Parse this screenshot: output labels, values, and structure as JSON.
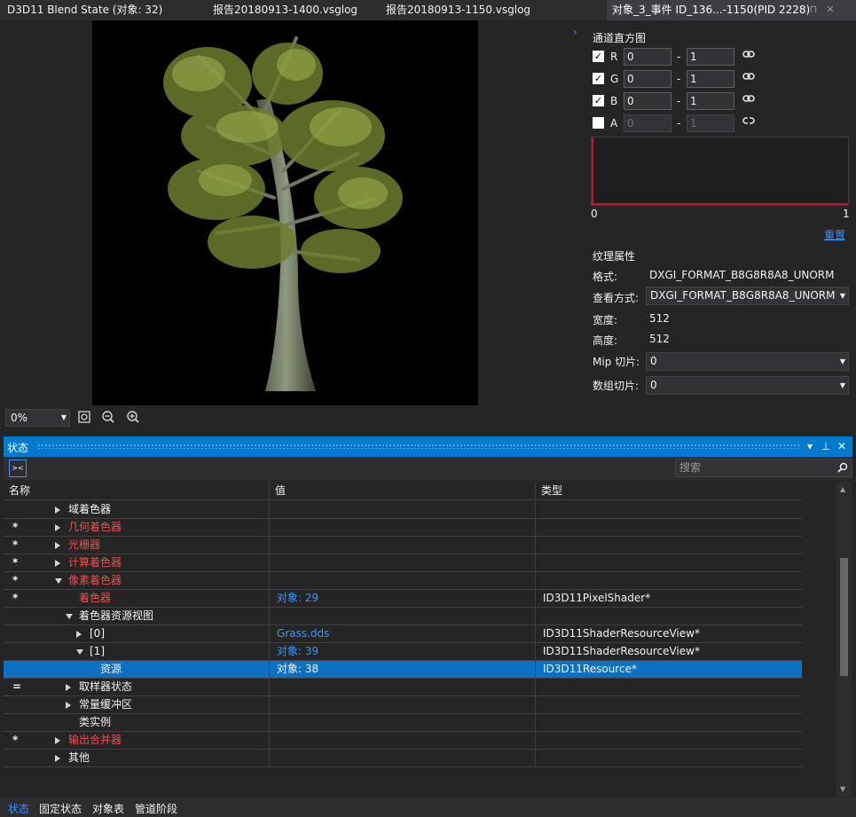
{
  "tabs": [
    {
      "label": "D3D11 Blend State (对象: 32)"
    },
    {
      "label": "报告20180913-1400.vsglog"
    },
    {
      "label": "报告20180913-1150.vsglog"
    },
    {
      "label": "对象_3_事件 ID_136...-1150(PID 2228)"
    }
  ],
  "right_panel": {
    "histogram_title": "通道直方图",
    "channels": [
      {
        "name": "R",
        "checked": true,
        "min": "0",
        "max": "1"
      },
      {
        "name": "G",
        "checked": true,
        "min": "0",
        "max": "1"
      },
      {
        "name": "B",
        "checked": true,
        "min": "0",
        "max": "1"
      },
      {
        "name": "A",
        "checked": false,
        "min": "0",
        "max": "1"
      }
    ],
    "dash": "-",
    "hist_min": "0",
    "hist_max": "1",
    "reset": "重置",
    "tex_props_title": "纹理属性",
    "format_label": "格式:",
    "format_value": "DXGI_FORMAT_B8G8R8A8_UNORM",
    "view_label": "查看方式:",
    "view_value": "DXGI_FORMAT_B8G8R8A8_UNORM",
    "width_label": "宽度:",
    "width_value": "512",
    "height_label": "高度:",
    "height_value": "512",
    "mip_label": "Mip 切片:",
    "mip_value": "0",
    "array_label": "数组切片:",
    "array_value": "0"
  },
  "zoom": {
    "value": "0%"
  },
  "status_window": {
    "title": "状态",
    "search_placeholder": "搜索",
    "columns": [
      "名称",
      "值",
      "类型"
    ],
    "rows": [
      {
        "mark": "",
        "indent": 1,
        "expander": "right",
        "name": "域着色器",
        "name_color": "white",
        "value": "",
        "value_color": "white",
        "type": ""
      },
      {
        "mark": "*",
        "indent": 1,
        "expander": "right",
        "name": "几何着色器",
        "name_color": "red",
        "value": "",
        "value_color": "white",
        "type": ""
      },
      {
        "mark": "*",
        "indent": 1,
        "expander": "right",
        "name": "光栅器",
        "name_color": "red",
        "value": "",
        "value_color": "white",
        "type": ""
      },
      {
        "mark": "*",
        "indent": 1,
        "expander": "right",
        "name": "计算着色器",
        "name_color": "red",
        "value": "",
        "value_color": "white",
        "type": ""
      },
      {
        "mark": "*",
        "indent": 1,
        "expander": "down",
        "name": "像素着色器",
        "name_color": "red",
        "value": "",
        "value_color": "white",
        "type": ""
      },
      {
        "mark": "*",
        "indent": 2,
        "expander": "",
        "name": "着色器",
        "name_color": "red",
        "value": "对象: 29",
        "value_color": "blue",
        "type": "ID3D11PixelShader*"
      },
      {
        "mark": "",
        "indent": 2,
        "expander": "down",
        "name": "着色器资源视图",
        "name_color": "white",
        "value": "",
        "value_color": "white",
        "type": ""
      },
      {
        "mark": "",
        "indent": 3,
        "expander": "right",
        "name": "[0]",
        "name_color": "white",
        "value": "Grass.dds",
        "value_color": "blue",
        "type": "ID3D11ShaderResourceView*"
      },
      {
        "mark": "",
        "indent": 3,
        "expander": "down",
        "name": "[1]",
        "name_color": "white",
        "value": "对象: 39",
        "value_color": "blue",
        "type": "ID3D11ShaderResourceView*"
      },
      {
        "mark": "",
        "indent": 4,
        "expander": "",
        "name": "资源",
        "name_color": "white",
        "value": "对象: 38",
        "value_color": "white",
        "type": "ID3D11Resource*",
        "selected": true
      },
      {
        "mark": "=",
        "indent": 2,
        "expander": "right",
        "name": "取样器状态",
        "name_color": "white",
        "value": "",
        "value_color": "white",
        "type": ""
      },
      {
        "mark": "",
        "indent": 2,
        "expander": "right",
        "name": "常量缓冲区",
        "name_color": "white",
        "value": "",
        "value_color": "white",
        "type": ""
      },
      {
        "mark": "",
        "indent": 2,
        "expander": "",
        "name": "类实例",
        "name_color": "white",
        "value": "",
        "value_color": "white",
        "type": ""
      },
      {
        "mark": "*",
        "indent": 1,
        "expander": "right",
        "name": "输出合并器",
        "name_color": "red",
        "value": "",
        "value_color": "white",
        "type": ""
      },
      {
        "mark": "",
        "indent": 1,
        "expander": "right",
        "name": "其他",
        "name_color": "white",
        "value": "",
        "value_color": "white",
        "type": ""
      }
    ]
  },
  "bottom_tabs": [
    {
      "label": "状态",
      "active": true
    },
    {
      "label": "固定状态",
      "active": false
    },
    {
      "label": "对象表",
      "active": false
    },
    {
      "label": "管道阶段",
      "active": false
    }
  ],
  "colors": {
    "accent": "#007acc",
    "link": "#3794ff",
    "changed": "#f14c4c",
    "selection": "#0e70c0"
  }
}
